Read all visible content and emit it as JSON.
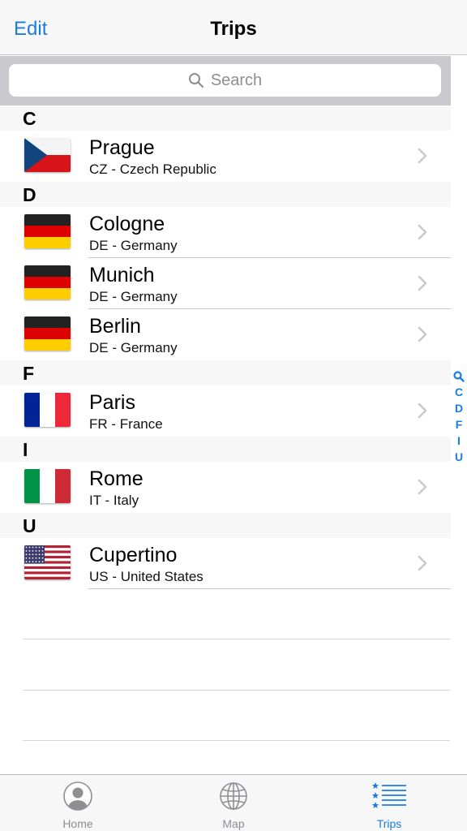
{
  "nav": {
    "edit_label": "Edit",
    "title": "Trips"
  },
  "search": {
    "placeholder": "Search"
  },
  "sections": [
    {
      "letter": "C",
      "trips": [
        {
          "city": "Prague",
          "country": "CZ - Czech Republic",
          "flag": "flag-czech-republic"
        }
      ]
    },
    {
      "letter": "D",
      "trips": [
        {
          "city": "Cologne",
          "country": "DE - Germany",
          "flag": "flag-germany"
        },
        {
          "city": "Munich",
          "country": "DE - Germany",
          "flag": "flag-germany"
        },
        {
          "city": "Berlin",
          "country": "DE - Germany",
          "flag": "flag-germany"
        }
      ]
    },
    {
      "letter": "F",
      "trips": [
        {
          "city": "Paris",
          "country": "FR - France",
          "flag": "flag-france"
        }
      ]
    },
    {
      "letter": "I",
      "trips": [
        {
          "city": "Rome",
          "country": "IT - Italy",
          "flag": "flag-italy"
        }
      ]
    },
    {
      "letter": "U",
      "trips": [
        {
          "city": "Cupertino",
          "country": "US - United States",
          "flag": "flag-united-states"
        }
      ]
    }
  ],
  "index": [
    "C",
    "D",
    "F",
    "I",
    "U"
  ],
  "tabs": [
    {
      "label": "Home",
      "icon": "person-icon"
    },
    {
      "label": "Map",
      "icon": "globe-icon"
    },
    {
      "label": "Trips",
      "icon": "starred-list-icon",
      "active": true
    }
  ],
  "colors": {
    "accent": "#1a7ee0",
    "separator": "#c8c7cc",
    "section_bg": "#f7f7f7"
  }
}
